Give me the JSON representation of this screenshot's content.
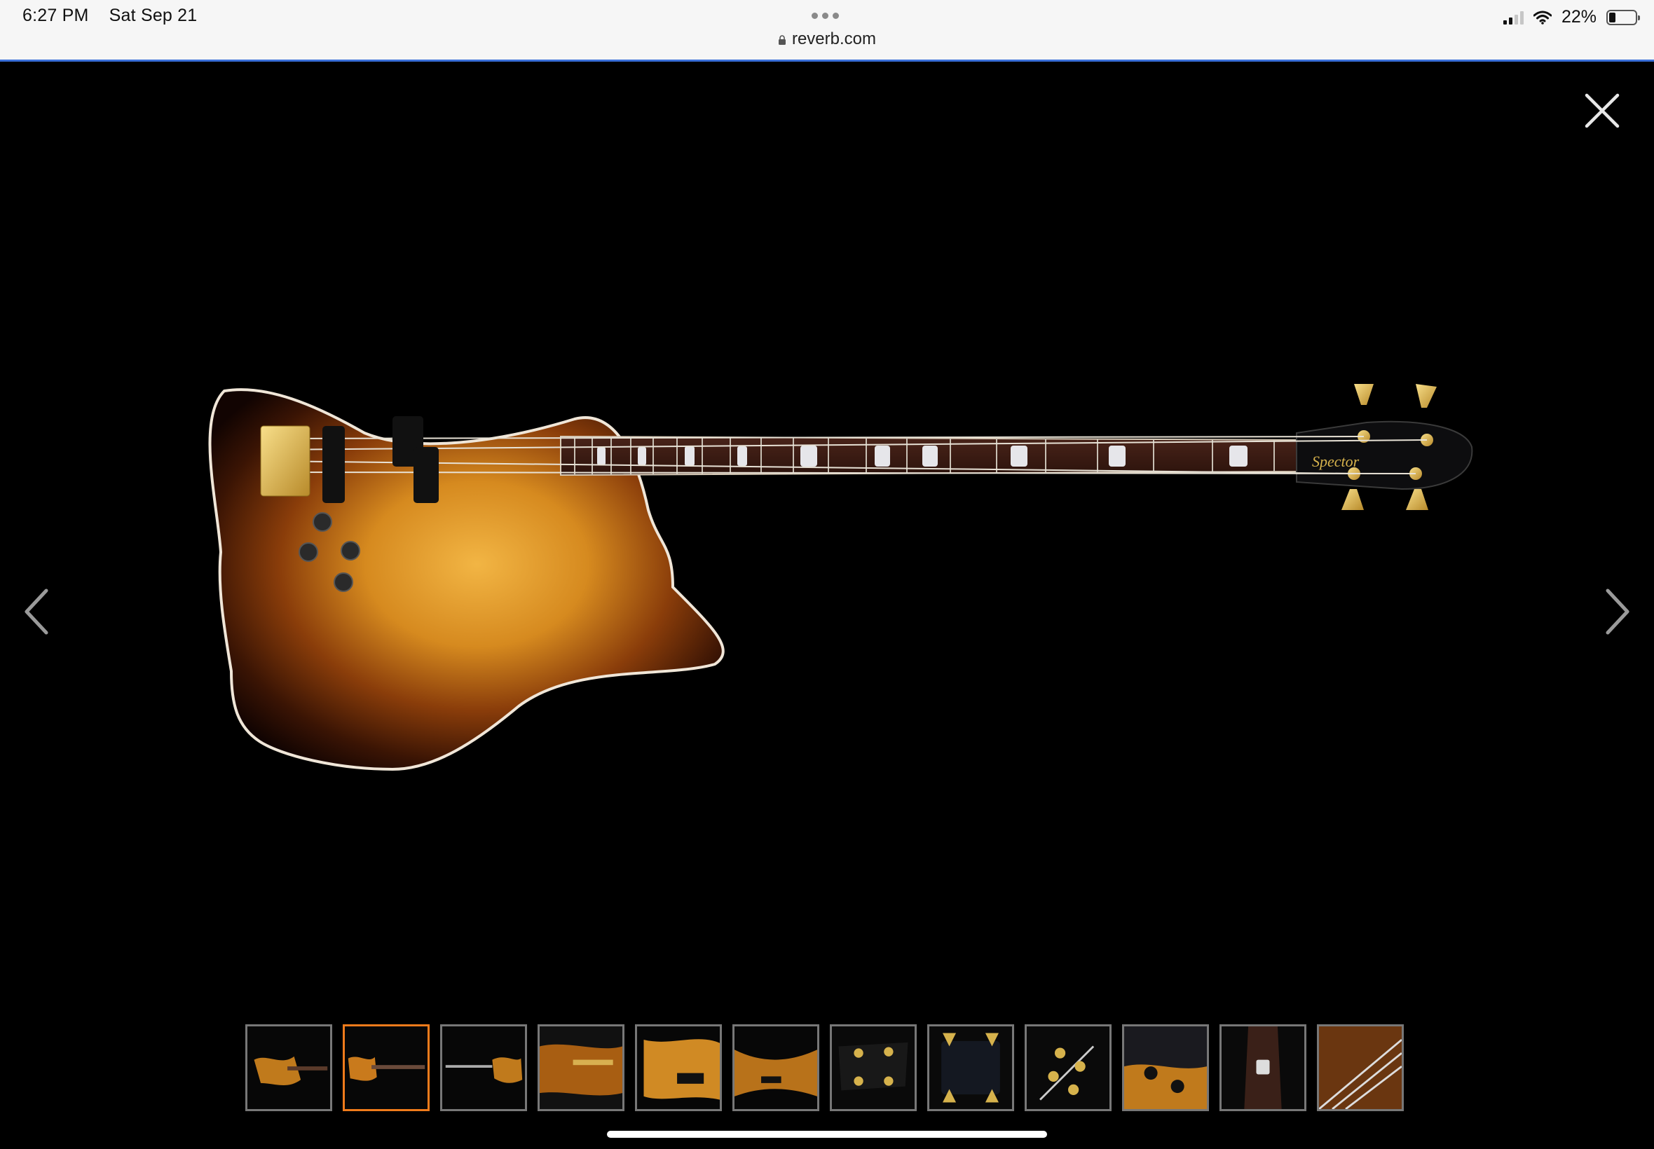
{
  "status_bar": {
    "time": "6:27 PM",
    "date": "Sat Sep 21",
    "url": "reverb.com",
    "battery_percent": "22%",
    "battery_level": 0.22,
    "icons": [
      "lock-icon",
      "cellular-signal-icon",
      "wifi-icon",
      "battery-icon"
    ]
  },
  "viewer": {
    "image_alt": "Spector bass guitar",
    "close_icon": "close-icon",
    "prev_icon": "chevron-left-icon",
    "next_icon": "chevron-right-icon",
    "headstock_logo_text": "Spector",
    "active_thumbnail_index": 1,
    "thumbnail_count": 12
  },
  "colors": {
    "accent": "#f07b1b",
    "progress_bar": "#3a6fd8",
    "background": "#000000"
  }
}
